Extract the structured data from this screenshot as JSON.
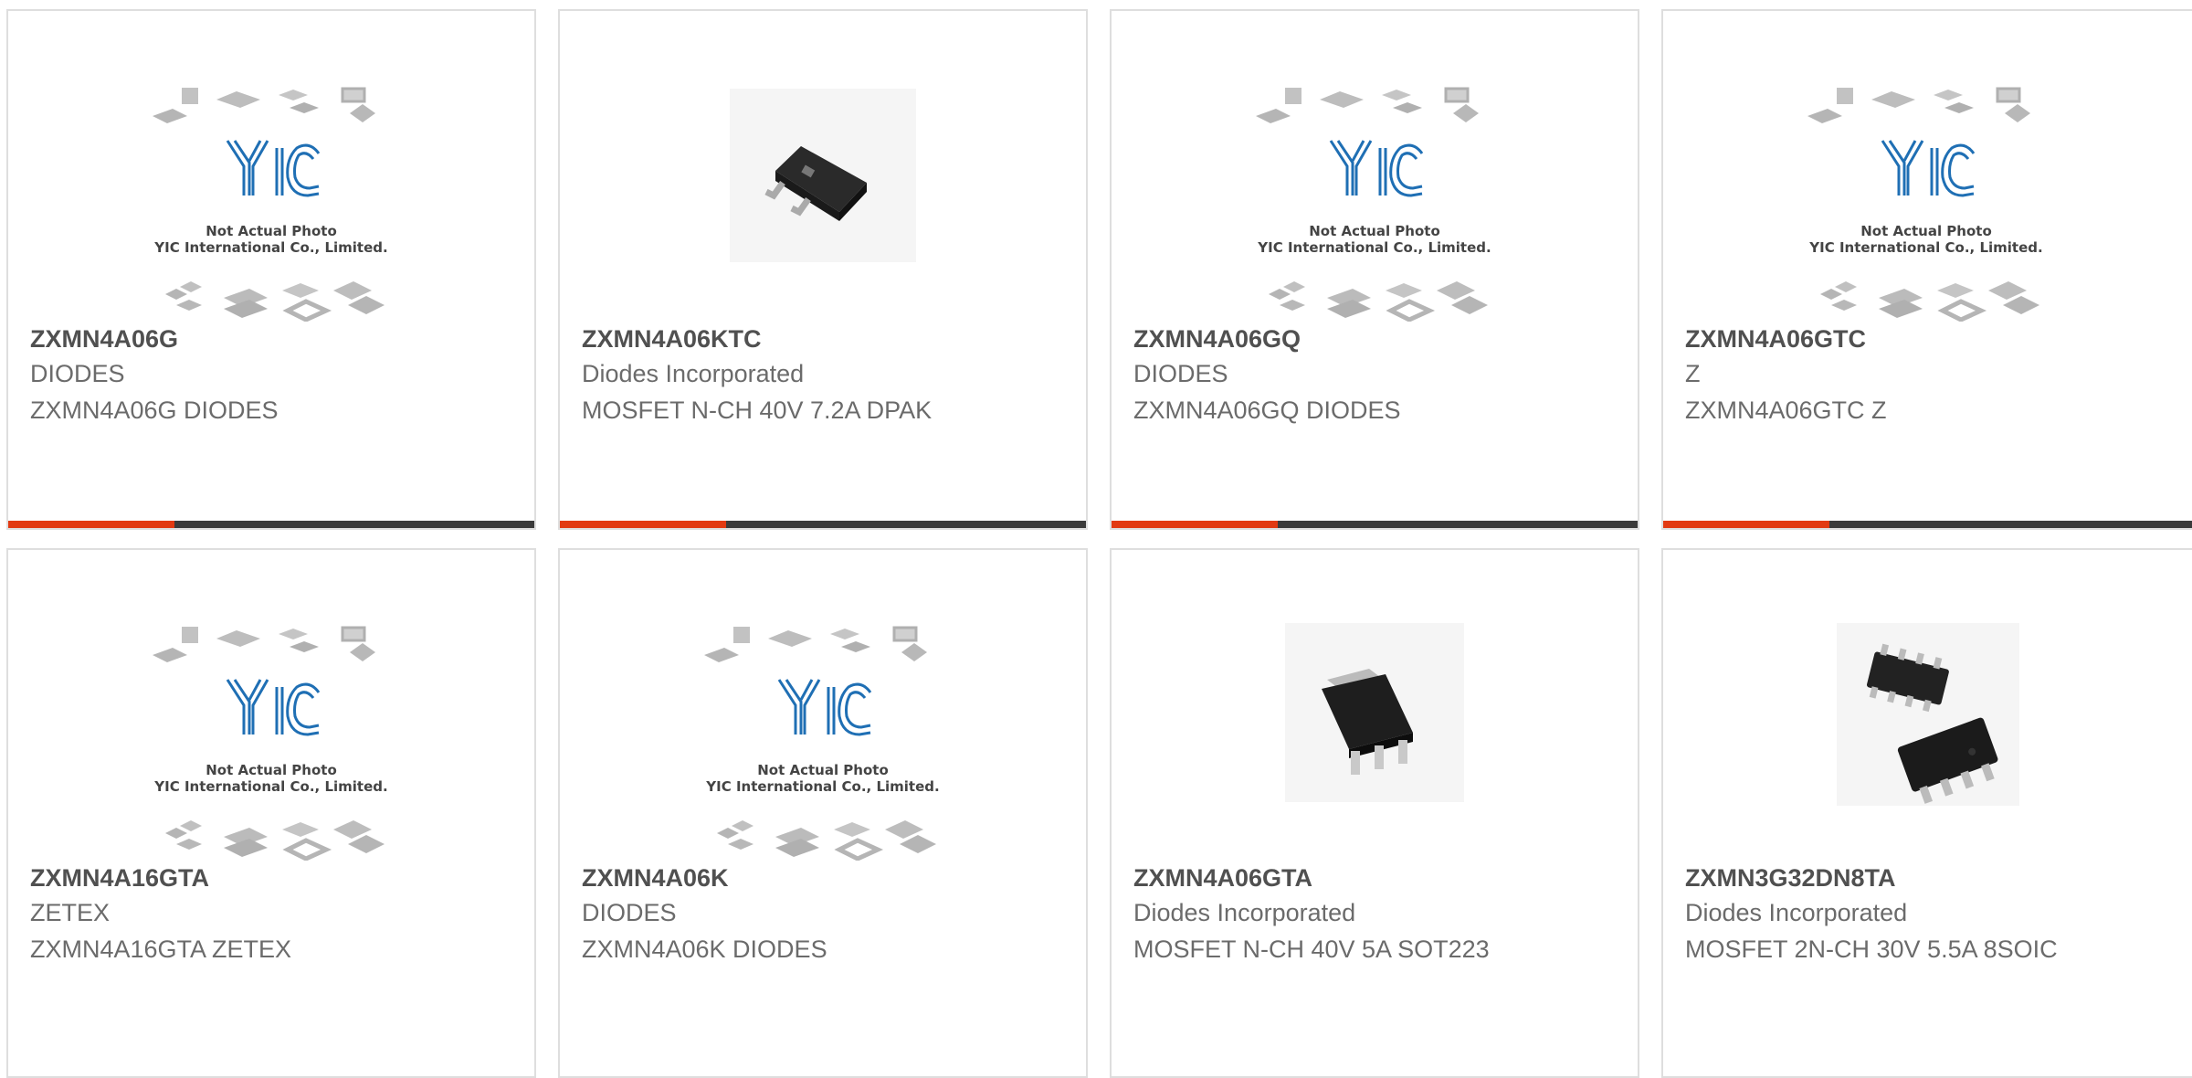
{
  "placeholder": {
    "caption_line1": "Not Actual Photo",
    "caption_line2": "YIC International Co., Limited."
  },
  "colors": {
    "accent": "#e23a12",
    "bar": "#3b3b3b",
    "logo_blue": "#1f6fb4"
  },
  "products": [
    {
      "part": "ZXMN4A06G",
      "maker": "DIODES",
      "desc": "ZXMN4A06G DIODES",
      "image": "placeholder-icon"
    },
    {
      "part": "ZXMN4A06KTC",
      "maker": "Diodes Incorporated",
      "desc": "MOSFET N-CH 40V 7.2A DPAK",
      "image": "dpak-package-icon"
    },
    {
      "part": "ZXMN4A06GQ",
      "maker": "DIODES",
      "desc": "ZXMN4A06GQ DIODES",
      "image": "placeholder-icon"
    },
    {
      "part": "ZXMN4A06GTC",
      "maker": "Z",
      "desc": "ZXMN4A06GTC Z",
      "image": "placeholder-icon"
    },
    {
      "part": "ZXMN4A16GTA",
      "maker": "ZETEX",
      "desc": "ZXMN4A16GTA ZETEX",
      "image": "placeholder-icon"
    },
    {
      "part": "ZXMN4A06K",
      "maker": "DIODES",
      "desc": "ZXMN4A06K DIODES",
      "image": "placeholder-icon"
    },
    {
      "part": "ZXMN4A06GTA",
      "maker": "Diodes Incorporated",
      "desc": "MOSFET N-CH 40V 5A SOT223",
      "image": "sot223-package-icon"
    },
    {
      "part": "ZXMN3G32DN8TA",
      "maker": "Diodes Incorporated",
      "desc": "MOSFET 2N-CH 30V 5.5A 8SOIC",
      "image": "soic8-package-icon"
    }
  ]
}
